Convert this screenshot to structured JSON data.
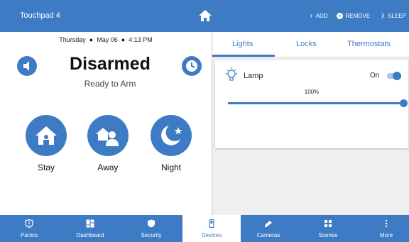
{
  "header": {
    "title": "Touchpad 4",
    "actions": [
      {
        "label": "ADD",
        "icon": "plus-icon"
      },
      {
        "label": "REMOVE",
        "icon": "minus-circle-icon"
      },
      {
        "label": "SLEEP",
        "icon": "moon-icon"
      }
    ]
  },
  "security": {
    "date": "Thursday",
    "day": "May 06",
    "time": "4:13 PM",
    "status": "Disarmed",
    "substatus": "Ready to Arm",
    "modes": [
      {
        "label": "Stay",
        "icon": "house-person-icon"
      },
      {
        "label": "Away",
        "icon": "house-people-icon"
      },
      {
        "label": "Night",
        "icon": "moon-star-icon"
      }
    ]
  },
  "devices": {
    "tabs": [
      "Lights",
      "Locks",
      "Thermostats"
    ],
    "active_tab": "Lights",
    "lights": [
      {
        "name": "Lamp",
        "state_label": "On",
        "is_on": true,
        "level_label": "100%",
        "level": 1.0
      }
    ]
  },
  "nav": {
    "items": [
      {
        "label": "Panics",
        "icon": "shield-alert-icon"
      },
      {
        "label": "Dashboard",
        "icon": "dashboard-icon"
      },
      {
        "label": "Security",
        "icon": "shield-icon"
      },
      {
        "label": "Devices",
        "icon": "device-icon"
      },
      {
        "label": "Cameras",
        "icon": "camera-icon"
      },
      {
        "label": "Scenes",
        "icon": "scenes-icon"
      },
      {
        "label": "More",
        "icon": "more-icon"
      }
    ],
    "active": "Devices"
  },
  "colors": {
    "accent": "#3d7cc4",
    "panel_bg": "#efefef"
  }
}
